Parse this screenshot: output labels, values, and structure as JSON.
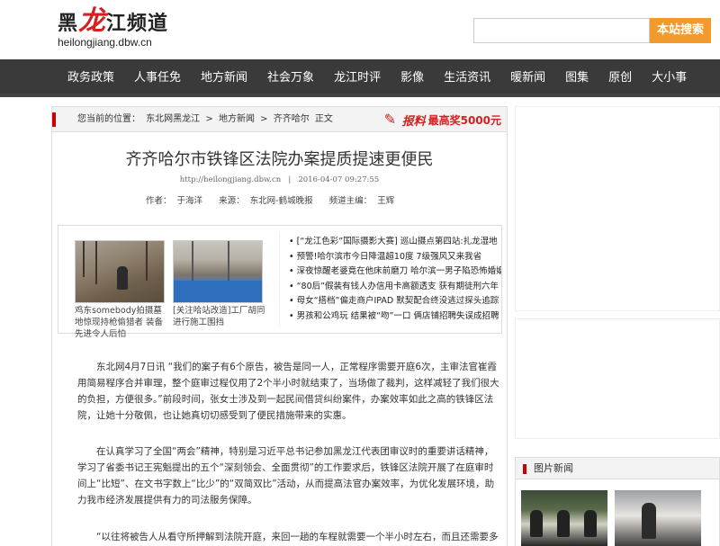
{
  "header": {
    "logo_main_prefix": "黑",
    "logo_main_red": "龙",
    "logo_main_suffix": "江频道",
    "logo_sub": "heilongjiang.dbw.cn",
    "search_placeholder": "",
    "search_button": "本站搜索"
  },
  "nav": {
    "items": [
      "政务政策",
      "人事任免",
      "地方新闻",
      "社会万象",
      "龙江时评",
      "影像",
      "生活资讯",
      "暖新闻",
      "图集",
      "原创",
      "大小事"
    ]
  },
  "breadcrumb": {
    "prefix": "您当前的位置：",
    "parts": [
      "东北网黑龙江",
      ">",
      "地方新闻",
      ">",
      "齐齐哈尔",
      "正文"
    ]
  },
  "report": {
    "label": "报料",
    "prize": "最高奖5000元"
  },
  "article": {
    "title": "齐齐哈尔市铁锋区法院办案提质提速更便民",
    "url": "http://heilongjiang.dbw.cn",
    "separator": "|",
    "datetime": "2016-04-07 09:27:55",
    "author_label": "作者：",
    "author": "于海洋",
    "source_label": "来源：",
    "source": "东北网-鹤城晚报",
    "editor_label": "频道主编：",
    "editor": "王辉"
  },
  "related": {
    "thumbs": [
      {
        "caption": "鸡东somebody拍摄墓地惊现持枪偷猎者 装备先进令人后怕"
      },
      {
        "caption": "[关注哈站改造]工厂胡同进行施工围挡"
      }
    ],
    "links": [
      "[“龙江色彩”国际摄影大赛] 巡山摄点第四站:扎龙湿地",
      "预警!哈尔滨市今日降温超10度 7级强风又来我省",
      "深夜惊醒老婆竟在他床前磨刀 哈尔滨一男子陷恐怖婚姻",
      "“80后”假装有钱人办信用卡高额透支 获有期徒刑六年",
      "母女“搭档”偏走商户IPAD 默契配合终没逃过探头追踪",
      "男孩和公鸡玩 结果被“吻”一口 俩店铺招聘失误成招聘"
    ]
  },
  "body": {
    "p1": "东北网4月7日讯 “我们的案子有6个原告，被告是同一人，正常程序需要开庭6次，主审法官崔霞用简易程序合并审理，整个庭审过程仅用了2个半小时就结束了，当场做了裁判，这样减轻了我们很大的负担，方便很多。”前段时间，张女士涉及到一起民间借贷纠纷案件，办案效率如此之高的铁锋区法院，让她十分敬佩，也让她真切切感受到了便民措施带来的实惠。",
    "p2": "在认真学习了全国“两会”精神，特别是习近平总书记参加黑龙江代表团审议时的重要讲话精神，学习了省委书记王宪魁提出的五个“深刻领会、全面贯彻”的工作要求后，铁锋区法院开展了在庭审时间上“比短”、在文书字数上“比少”的“双简双比”活动，从而提高法官办案效率，为优化发展环境，助力我市经济发展提供有力的司法服务保障。",
    "p3": "“以往将被告人从看守所押解到法院开庭，来回一趟的车程就需要一个半小时左右，而且还需要多名法"
  },
  "sidebar": {
    "pic_news_title": "图片新闻"
  },
  "colors": {
    "nav_bg": "#3a3a3a",
    "search_btn": "#f39a2c",
    "accent_red": "#d42020"
  }
}
